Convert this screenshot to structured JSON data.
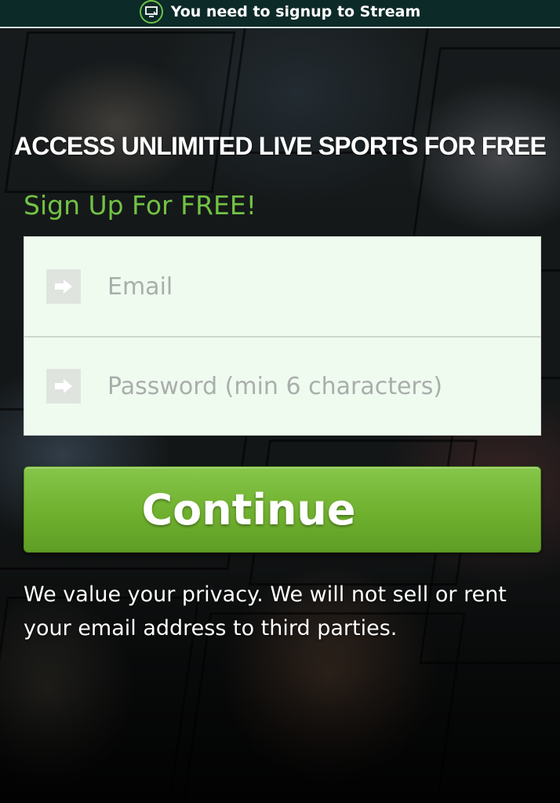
{
  "banner": {
    "text": "You need to signup to Stream",
    "icon": "monitor-icon"
  },
  "headline": "ACCESS UNLIMITED LIVE SPORTS FOR FREE",
  "signup_title": "Sign Up For FREE!",
  "form": {
    "email": {
      "placeholder": "Email",
      "value": "",
      "icon": "arrow-right-icon"
    },
    "password": {
      "placeholder": "Password (min 6 characters)",
      "value": "",
      "icon": "arrow-right-icon"
    }
  },
  "continue_label": "Continue",
  "privacy_text": "We value your privacy. We will not sell or rent your email address to third parties.",
  "colors": {
    "accent_green": "#72c244",
    "button_green": "#6fb02e",
    "banner_bg": "#0c2a28",
    "form_bg": "#f0fbf0"
  }
}
